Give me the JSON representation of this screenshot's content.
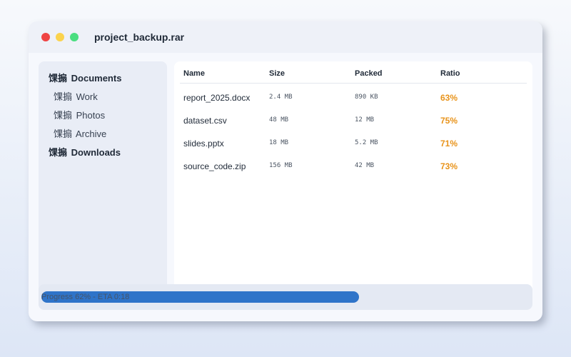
{
  "window": {
    "title": "project_backup.rar",
    "buttons": [
      {
        "name": "close",
        "color": "#ef4444"
      },
      {
        "name": "minimize",
        "color": "#fbd34d"
      },
      {
        "name": "maximize",
        "color": "#4ade80"
      }
    ]
  },
  "sidebar": {
    "folder_glyph": "馃搧",
    "items": [
      {
        "label": "Documents",
        "level": 0
      },
      {
        "label": "Work",
        "level": 1
      },
      {
        "label": "Photos",
        "level": 1
      },
      {
        "label": "Archive",
        "level": 1
      },
      {
        "label": "Downloads",
        "level": 0
      }
    ]
  },
  "table": {
    "columns": [
      "Name",
      "Size",
      "Packed",
      "Ratio"
    ],
    "rows": [
      {
        "name": "report_2025.docx",
        "size": "2.4 MB",
        "packed": "890 KB",
        "ratio": "63%"
      },
      {
        "name": "dataset.csv",
        "size": "48 MB",
        "packed": "12 MB",
        "ratio": "75%"
      },
      {
        "name": "slides.pptx",
        "size": "18 MB",
        "packed": "5.2 MB",
        "ratio": "71%"
      },
      {
        "name": "source_code.zip",
        "size": "156 MB",
        "packed": "42 MB",
        "ratio": "73%"
      }
    ],
    "ratio_color": "#e8931a"
  },
  "status": {
    "text": "Progress 62% - ETA 0:18",
    "progress": 0.65,
    "bar_color": "#2f74c9"
  }
}
